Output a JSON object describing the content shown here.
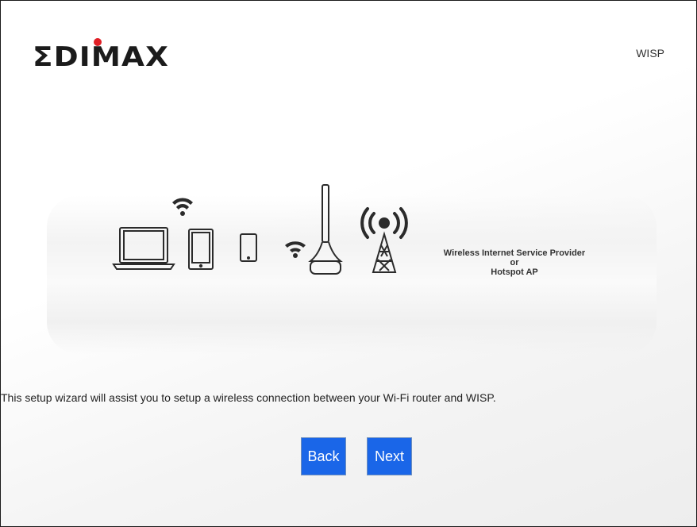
{
  "brand": {
    "logo_text": "EDIMAX",
    "accent_dot": "#e01f26"
  },
  "header": {
    "mode_label": "WISP"
  },
  "illustration": {
    "provider_line1": "Wireless Internet Service Provider",
    "provider_line2": "or",
    "provider_line3": "Hotspot AP"
  },
  "main": {
    "description": "This setup wizard will assist you to setup a wireless connection between your Wi-Fi router and WISP."
  },
  "buttons": {
    "back_label": "Back",
    "next_label": "Next"
  },
  "colors": {
    "button_bg": "#1a66e8",
    "button_text": "#ffffff"
  }
}
